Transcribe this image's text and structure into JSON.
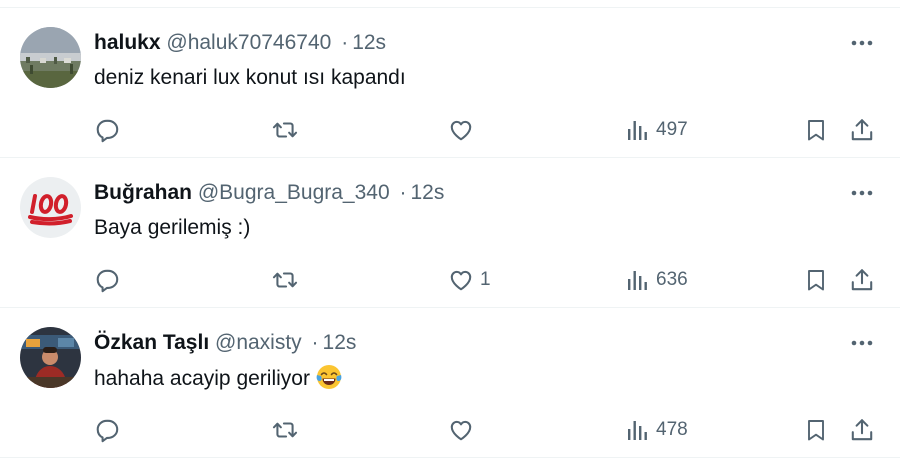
{
  "tweets": [
    {
      "name": "halukx",
      "handle": "@haluk70746740",
      "separator": "·",
      "time": "12s",
      "text": "deniz kenari lux konut ısı kapandı",
      "avatar": "landscape-photo",
      "likes": "",
      "views": "497"
    },
    {
      "name": "Buğrahan",
      "handle": "@Bugra_Bugra_340",
      "separator": "·",
      "time": "12s",
      "text": "Baya gerilemiş :)",
      "avatar": "hundred-points-emoji",
      "likes": "1",
      "views": "636"
    },
    {
      "name": "Özkan Taşlı",
      "handle": "@naxisty",
      "separator": "·",
      "time": "12s",
      "text": "hahaha acayip geriliyor",
      "emoji": "face-with-tears-of-joy",
      "avatar": "person-photo",
      "likes": "",
      "views": "478"
    }
  ],
  "icons": {
    "reply": "reply-icon",
    "retweet": "retweet-icon",
    "like": "heart-icon",
    "views": "views-icon",
    "bookmark": "bookmark-icon",
    "share": "share-icon",
    "more": "more-options-icon"
  },
  "colors": {
    "text": "#0f1419",
    "secondary": "#536471",
    "divider": "#eff3f4"
  }
}
